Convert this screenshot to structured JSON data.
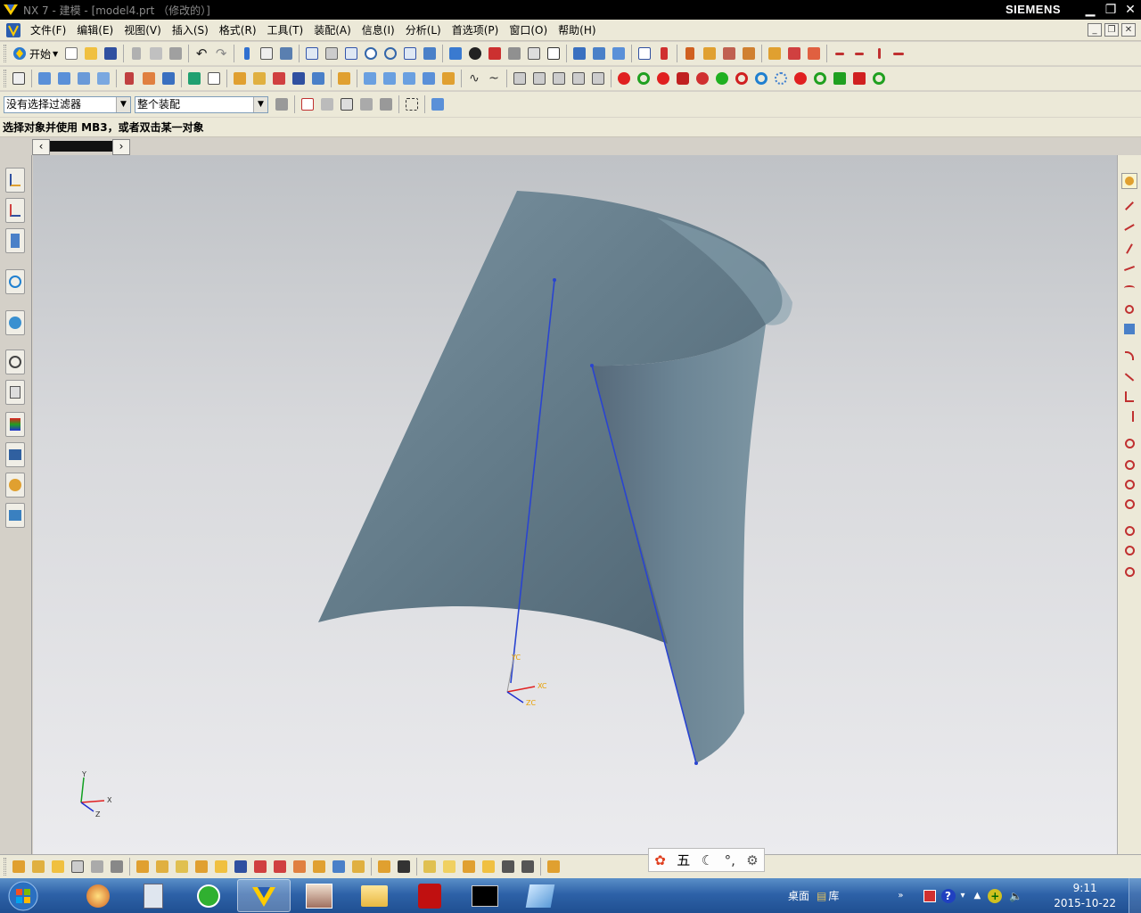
{
  "window": {
    "title": "NX 7 - 建模 - [model4.prt （修改的）]",
    "brand": "SIEMENS"
  },
  "menu": [
    "文件(F)",
    "编辑(E)",
    "视图(V)",
    "插入(S)",
    "格式(R)",
    "工具(T)",
    "装配(A)",
    "信息(I)",
    "分析(L)",
    "首选项(P)",
    "窗口(O)",
    "帮助(H)"
  ],
  "toolbar": {
    "start_label": "开始"
  },
  "filters": {
    "type_filter": "没有选择过滤器",
    "scope_filter": "整个装配"
  },
  "cue_line": "选择对象并使用 MB3，或者双击某一对象",
  "triads": {
    "wcs": {
      "x": "XC",
      "y": "YC",
      "z": "ZC"
    },
    "view": {
      "x": "X",
      "y": "Y",
      "z": "Z"
    }
  },
  "ime": {
    "mode": "五"
  },
  "taskbar": {
    "tray_desktop": "桌面",
    "tray_library": "库",
    "time": "9:11",
    "date": "2015-10-22"
  },
  "colors": {
    "surface": "#66808f",
    "edge": "#3344cc",
    "triad_x": "#e02020",
    "triad_y": "#10a020",
    "triad_z": "#2030d0",
    "accent": "#e8a000"
  }
}
